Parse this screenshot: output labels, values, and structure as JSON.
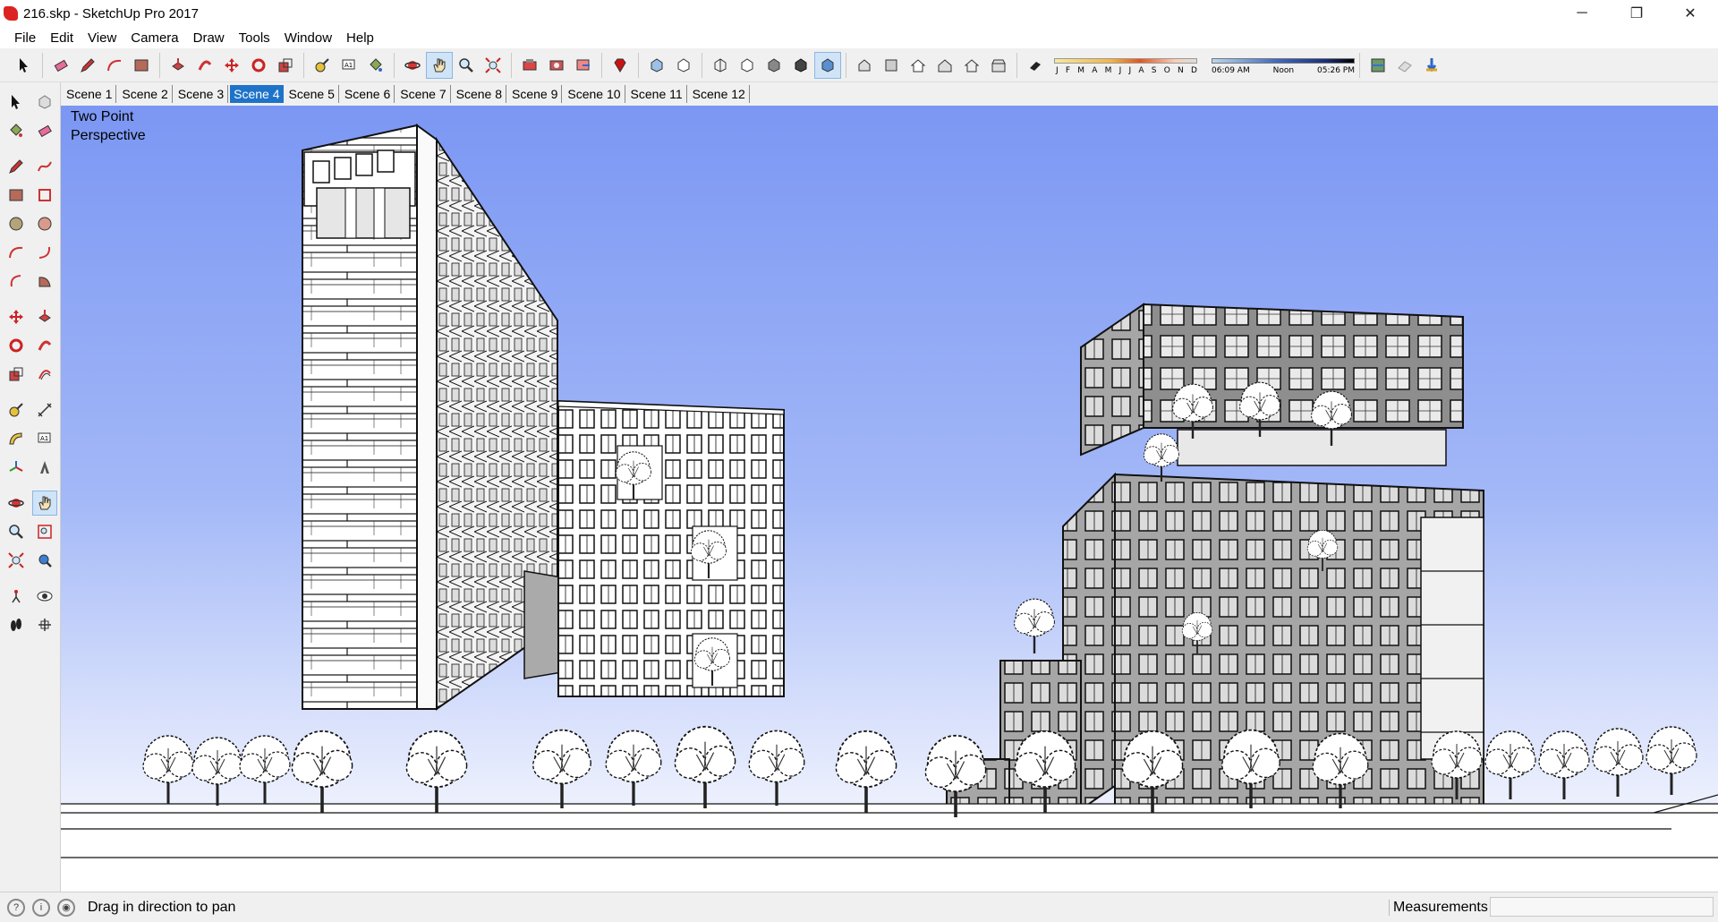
{
  "window": {
    "title": "216.skp - SketchUp Pro 2017",
    "controls": {
      "minimize": "─",
      "maximize": "❐",
      "close": "✕"
    }
  },
  "menu": [
    "File",
    "Edit",
    "View",
    "Camera",
    "Draw",
    "Tools",
    "Window",
    "Help"
  ],
  "shadow": {
    "months": [
      "J",
      "F",
      "M",
      "A",
      "M",
      "J",
      "J",
      "A",
      "S",
      "O",
      "N",
      "D"
    ],
    "time_start": "06:09 AM",
    "time_mid": "Noon",
    "time_end": "05:26 PM"
  },
  "scenes": {
    "tabs": [
      "Scene 1",
      "Scene 2",
      "Scene 3",
      "Scene 4",
      "Scene 5",
      "Scene 6",
      "Scene 7",
      "Scene 8",
      "Scene 9",
      "Scene 10",
      "Scene 11",
      "Scene 12"
    ],
    "active": "Scene 4"
  },
  "viewport": {
    "label_line1": "Two Point",
    "label_line2": "Perspective"
  },
  "status": {
    "message": "Drag in direction to pan",
    "measurements_label": "Measurements",
    "measurements_value": ""
  },
  "colors": {
    "sky_top": "#7b97f3",
    "active_tab": "#1e73c9",
    "building_gray": "#a9a9a9"
  }
}
